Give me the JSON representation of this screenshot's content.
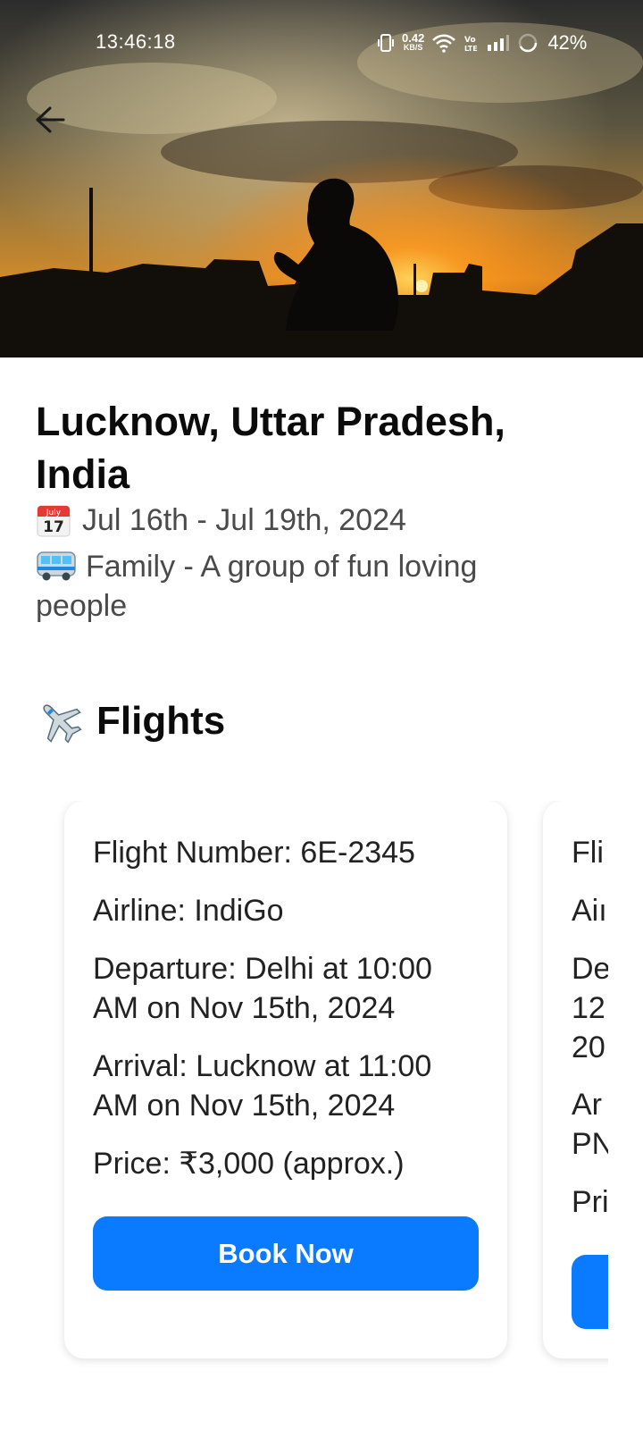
{
  "status_bar": {
    "time": "13:46:18",
    "net_speed_value": "0.42",
    "net_speed_unit": "KB/S",
    "battery": "42%",
    "icons": [
      "vibrate-icon",
      "wifi-icon",
      "volte-icon",
      "signal-icon",
      "battery-icon"
    ]
  },
  "hero": {
    "back_icon": "arrow-left-icon"
  },
  "trip": {
    "title": "Lucknow, Uttar Pradesh, India",
    "dates": "Jul 16th -  Jul 19th, 2024",
    "calendar_icon_month": "July",
    "calendar_icon_day": "17",
    "group": "Family - A group of fun loving people"
  },
  "flights": {
    "heading": "Flights",
    "cards": [
      {
        "flight_number": "Flight Number: 6E-2345",
        "airline": "Airline: IndiGo",
        "departure": "Departure: Delhi at 10:00 AM on Nov 15th, 2024",
        "arrival": "Arrival: Lucknow at 11:00 AM on Nov 15th, 2024",
        "price": "Price: ₹3,000 (approx.)",
        "button": "Book Now"
      },
      {
        "flight_number": "Fli",
        "airline": "Aiı",
        "departure_1": "De",
        "departure_2": "12",
        "departure_3": "20",
        "arrival_1": "Ar",
        "arrival_2": "PN",
        "price": "Pri",
        "button": ""
      }
    ]
  },
  "colors": {
    "accent": "#0a7aff",
    "text_primary": "#0b0b0b",
    "text_secondary": "#4a4a4a"
  }
}
